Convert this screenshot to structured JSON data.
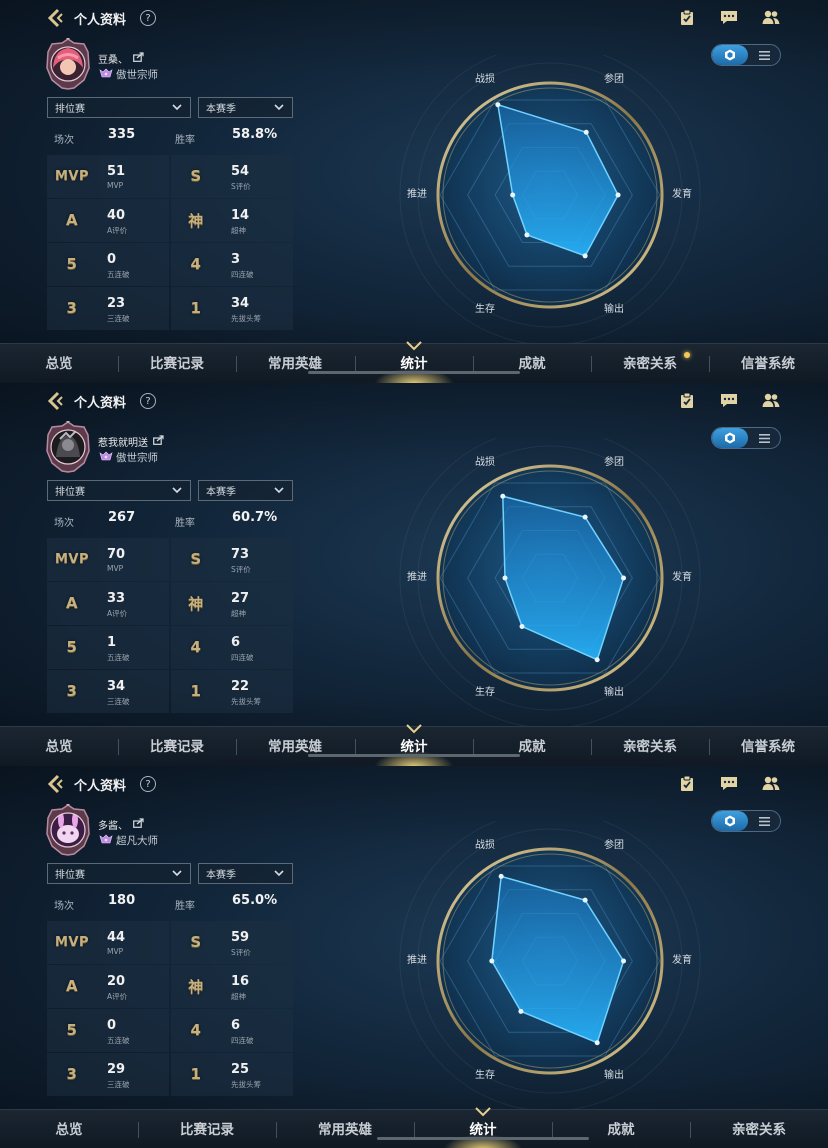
{
  "app": {
    "title": "个人资料",
    "help_icon": "?"
  },
  "colors": {
    "gold": "#c5b07e",
    "accent": "#2f8fd8",
    "radar_fill": "#1fa8ff"
  },
  "toggle": {
    "left_icon": "radar-view-icon",
    "right_icon": "list-view-icon"
  },
  "radar_axes": [
    "战损",
    "参团",
    "发育",
    "输出",
    "生存",
    "推进"
  ],
  "nav_tabs_full": [
    "总览",
    "比赛记录",
    "常用英雄",
    "统计",
    "成就",
    "亲密关系",
    "信誉系统"
  ],
  "nav_tabs_third": [
    "总览",
    "比赛记录",
    "常用英雄",
    "统计",
    "成就",
    "亲密关系"
  ],
  "panels": [
    {
      "profile": {
        "name": "豆桑、",
        "rank": "傲世宗师",
        "avatar": "pink-hair-hero-avatar"
      },
      "filters": {
        "mode": "排位赛",
        "season": "本赛季"
      },
      "summary": {
        "games_label": "场次",
        "games": "335",
        "winrate_label": "胜率",
        "winrate": "58.8%"
      },
      "stats": [
        {
          "badge": "MVP",
          "value": "51",
          "label": "MVP"
        },
        {
          "badge": "S",
          "value": "54",
          "label": "S评价"
        },
        {
          "badge": "A",
          "value": "40",
          "label": "A评价"
        },
        {
          "badge": "神",
          "value": "14",
          "label": "超神"
        },
        {
          "badge": "5",
          "value": "0",
          "label": "五连破"
        },
        {
          "badge": "4",
          "value": "3",
          "label": "四连破"
        },
        {
          "badge": "3",
          "value": "23",
          "label": "三连破"
        },
        {
          "badge": "1",
          "value": "34",
          "label": "先拔头筹"
        }
      ],
      "radar_values": [
        0.95,
        0.66,
        0.62,
        0.64,
        0.42,
        0.34
      ],
      "nav_active": "统计"
    },
    {
      "profile": {
        "name": "惹我就明送",
        "rank": "傲世宗师",
        "avatar": "dark-armored-hero-avatar"
      },
      "filters": {
        "mode": "排位赛",
        "season": "本赛季"
      },
      "summary": {
        "games_label": "场次",
        "games": "267",
        "winrate_label": "胜率",
        "winrate": "60.7%"
      },
      "stats": [
        {
          "badge": "MVP",
          "value": "70",
          "label": "MVP"
        },
        {
          "badge": "S",
          "value": "73",
          "label": "S评价"
        },
        {
          "badge": "A",
          "value": "33",
          "label": "A评价"
        },
        {
          "badge": "神",
          "value": "27",
          "label": "超神"
        },
        {
          "badge": "5",
          "value": "1",
          "label": "五连破"
        },
        {
          "badge": "4",
          "value": "6",
          "label": "四连破"
        },
        {
          "badge": "3",
          "value": "34",
          "label": "三连破"
        },
        {
          "badge": "1",
          "value": "22",
          "label": "先拔头筹"
        }
      ],
      "radar_values": [
        0.86,
        0.64,
        0.67,
        0.86,
        0.51,
        0.41
      ],
      "nav_active": "统计"
    },
    {
      "profile": {
        "name": "多酱、",
        "rank": "超凡大师",
        "avatar": "pink-bunny-hero-avatar"
      },
      "filters": {
        "mode": "排位赛",
        "season": "本赛季"
      },
      "summary": {
        "games_label": "场次",
        "games": "180",
        "winrate_label": "胜率",
        "winrate": "65.0%"
      },
      "stats": [
        {
          "badge": "MVP",
          "value": "44",
          "label": "MVP"
        },
        {
          "badge": "S",
          "value": "59",
          "label": "S评价"
        },
        {
          "badge": "A",
          "value": "20",
          "label": "A评价"
        },
        {
          "badge": "神",
          "value": "16",
          "label": "超神"
        },
        {
          "badge": "5",
          "value": "0",
          "label": "五连破"
        },
        {
          "badge": "4",
          "value": "6",
          "label": "四连破"
        },
        {
          "badge": "3",
          "value": "29",
          "label": "三连破"
        },
        {
          "badge": "1",
          "value": "25",
          "label": "先拔头筹"
        }
      ],
      "radar_values": [
        0.89,
        0.64,
        0.67,
        0.86,
        0.53,
        0.53
      ],
      "nav_active": "统计"
    }
  ]
}
